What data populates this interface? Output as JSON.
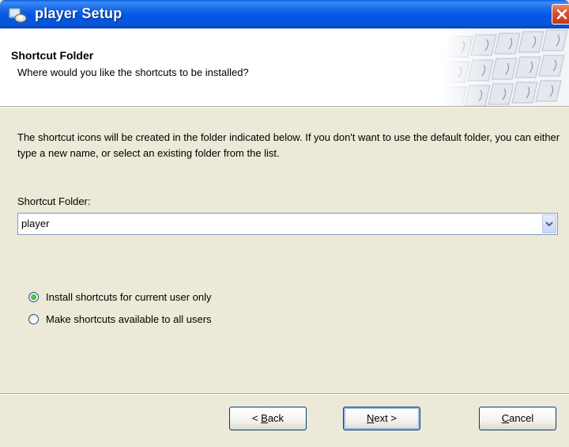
{
  "window": {
    "title": "player Setup",
    "icon": "installer-app-icon",
    "close_icon": "close-icon"
  },
  "header": {
    "title": "Shortcut Folder",
    "subtitle": "Where would you like the shortcuts to be installed?"
  },
  "body": {
    "description": "The shortcut icons will be created in the folder indicated below. If you don't want to use the default folder, you can either type a new name, or select an existing folder from the list.",
    "folder_label": "Shortcut Folder:",
    "folder_value": "player"
  },
  "options": [
    {
      "label": "Install shortcuts for current user only",
      "selected": true
    },
    {
      "label": "Make shortcuts available to all users",
      "selected": false
    }
  ],
  "buttons": {
    "back": {
      "prefix": "< ",
      "mnemonic": "B",
      "rest": "ack"
    },
    "next": {
      "mnemonic": "N",
      "rest": "ext >"
    },
    "cancel": {
      "mnemonic": "C",
      "rest": "ancel"
    }
  },
  "colors": {
    "titlebar": "#0055e5",
    "dialog_bg": "#ece9d8",
    "close_button": "#d8502a"
  }
}
